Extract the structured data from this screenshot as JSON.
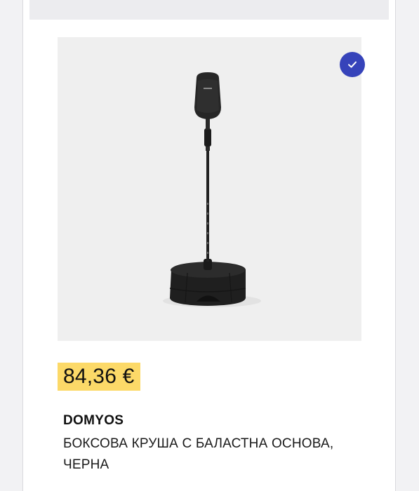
{
  "product": {
    "price": "84,36 €",
    "brand": "DOMYOS",
    "title": "БОКСОВА КРУША С БАЛАСТНА ОСНОВА, ЧЕРНА",
    "image_alt": "Боксова круша с баластна основа",
    "selected": true
  },
  "colors": {
    "accent": "#3643ba",
    "price_highlight": "#fcd968",
    "image_background": "#efefef"
  },
  "icons": {
    "selected_badge": "check-icon"
  }
}
